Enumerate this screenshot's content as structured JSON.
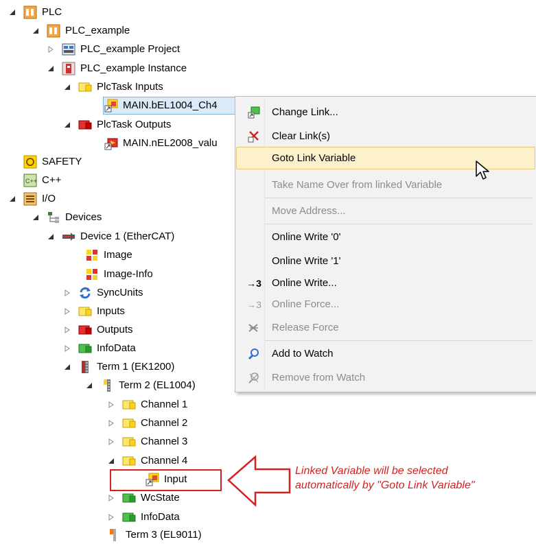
{
  "tree": {
    "plc": "PLC",
    "plc_example": "PLC_example",
    "plc_project": "PLC_example Project",
    "plc_instance": "PLC_example Instance",
    "plctask_inputs": "PlcTask Inputs",
    "main_input_var": "MAIN.bEL1004_Ch4",
    "plctask_outputs": "PlcTask Outputs",
    "main_output_var": "MAIN.nEL2008_valu",
    "safety": "SAFETY",
    "cpp": "C++",
    "io": "I/O",
    "devices": "Devices",
    "device1": "Device 1 (EtherCAT)",
    "image": "Image",
    "image_info": "Image-Info",
    "syncunits": "SyncUnits",
    "inputs": "Inputs",
    "outputs": "Outputs",
    "infodata": "InfoData",
    "term1": "Term 1 (EK1200)",
    "term2": "Term 2 (EL1004)",
    "channel1": "Channel 1",
    "channel2": "Channel 2",
    "channel3": "Channel 3",
    "channel4": "Channel 4",
    "input": "Input",
    "wcstate": "WcState",
    "infodata2": "InfoData",
    "term3": "Term 3 (EL9011)"
  },
  "context_menu": {
    "change_link": "Change Link...",
    "clear_links": "Clear Link(s)",
    "goto_link": "Goto Link Variable",
    "take_name": "Take Name Over from linked Variable",
    "move_address": "Move Address...",
    "online_write_0": "Online Write '0'",
    "online_write_1": "Online Write '1'",
    "online_write": "Online Write...",
    "online_force": "Online Force...",
    "release_force": "Release Force",
    "add_watch": "Add to Watch",
    "remove_watch": "Remove from Watch",
    "online_write_glyph": "→3",
    "online_force_glyph": "→3"
  },
  "callout": {
    "line1": "Linked Variable will be selected",
    "line2": "automatically by \"Goto Link Variable\""
  },
  "colors": {
    "annotation_red": "#d42020",
    "highlight_fill": "#fdf1cc",
    "highlight_border": "#e8c877",
    "selection_fill": "#dbeaf9"
  }
}
